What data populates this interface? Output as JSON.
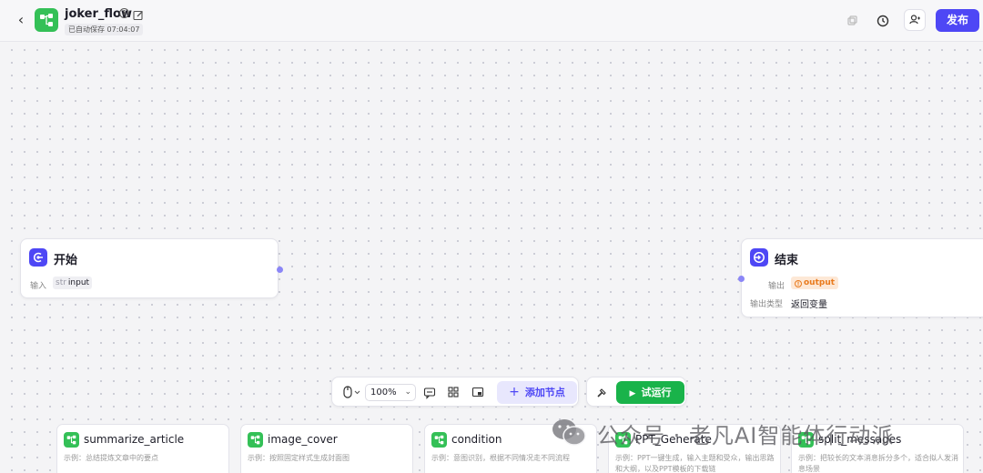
{
  "header": {
    "back_icon": "chevron-left-icon",
    "app_icon": "workflow-icon",
    "title": "joker_flow",
    "save_status": "已自动保存 07:04:07",
    "publish_label": "发布",
    "accent_color": "#4e47f5"
  },
  "nodes": {
    "start": {
      "title": "开始",
      "input_label": "输入",
      "input_type": "str",
      "input_name": "input"
    },
    "end": {
      "title": "结束",
      "output_label": "输出",
      "output_name": "output",
      "output_type_label": "输出类型",
      "output_type_value": "返回变量"
    }
  },
  "toolbar": {
    "zoom": "100%",
    "add_node_label": "添加节点",
    "run_label": "试运行",
    "run_color": "#19b34a"
  },
  "plugins": [
    {
      "title": "summarize_article",
      "desc": "示例：总结提炼文章中的要点"
    },
    {
      "title": "image_cover",
      "desc": "示例：按照固定样式生成封面图"
    },
    {
      "title": "condition",
      "desc": "示例：意图识别，根据不同情况走不同流程"
    },
    {
      "title": "PPT_Generate",
      "desc": "示例：PPT一键生成，输入主题和受众，输出思路和大纲，以及PPT模板的下载链"
    },
    {
      "title": "split_messages",
      "desc": "示例：把较长的文本消息拆分多个，适合拟人发消息场景"
    }
  ],
  "watermark": {
    "text": "公众号 · 老凡AI智能体行动派"
  }
}
